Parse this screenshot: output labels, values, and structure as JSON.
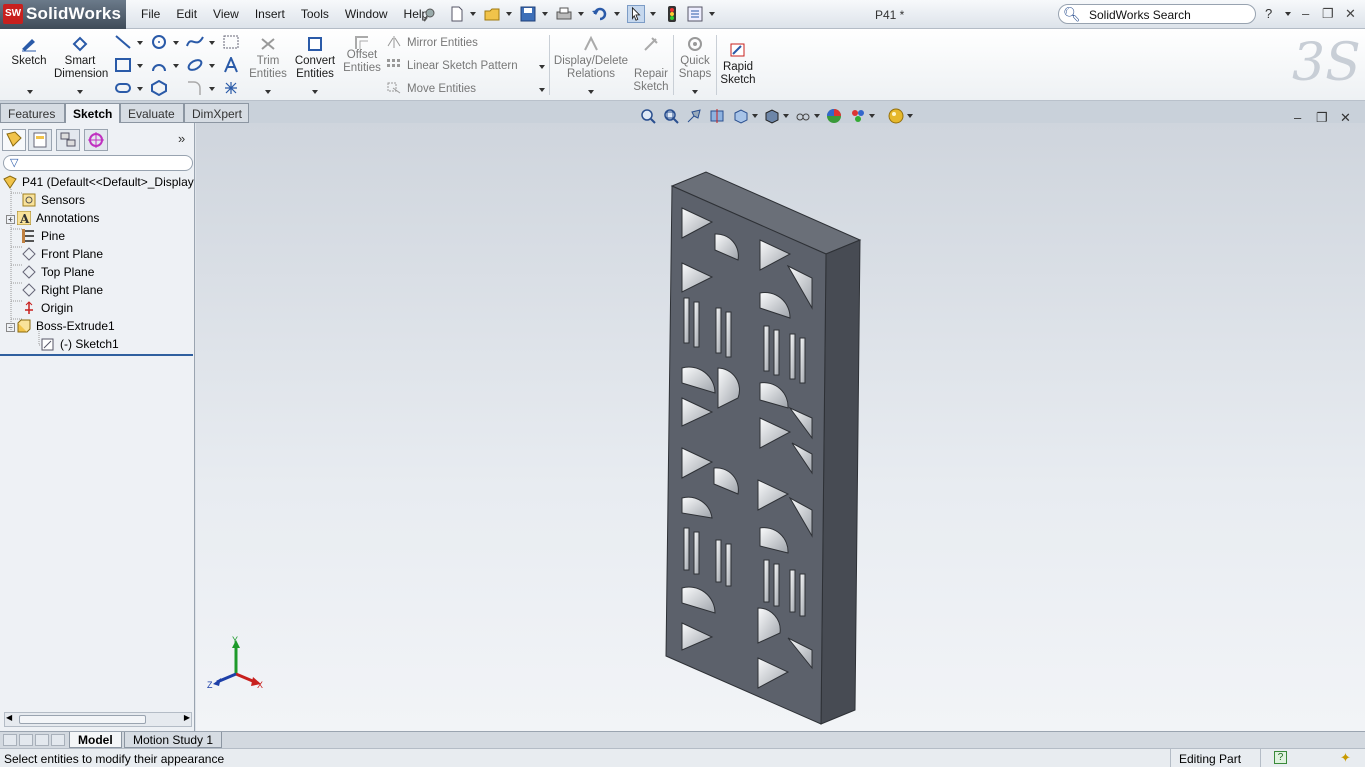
{
  "app": {
    "logo_badge": "SW",
    "logo_name": "SolidWorks",
    "document_title": "P41 *"
  },
  "menu": [
    "File",
    "Edit",
    "View",
    "Insert",
    "Tools",
    "Window",
    "Help"
  ],
  "search": {
    "placeholder": "SolidWorks Search"
  },
  "ribbon": {
    "sketch": "Sketch",
    "smart_dimension_1": "Smart",
    "smart_dimension_2": "Dimension",
    "trim_1": "Trim",
    "trim_2": "Entities",
    "convert_1": "Convert",
    "convert_2": "Entities",
    "offset_1": "Offset",
    "offset_2": "Entities",
    "mirror": "Mirror Entities",
    "linear_pattern": "Linear Sketch Pattern",
    "move": "Move Entities",
    "display_delete_1": "Display/Delete",
    "display_delete_2": "Relations",
    "repair_1": "Repair",
    "repair_2": "Sketch",
    "quick_snaps_1": "Quick",
    "quick_snaps_2": "Snaps",
    "rapid_sketch_1": "Rapid",
    "rapid_sketch_2": "Sketch"
  },
  "tabs": [
    "Features",
    "Sketch",
    "Evaluate",
    "DimXpert"
  ],
  "active_tab": "Sketch",
  "feature_tree": {
    "root": "P41  (Default<<Default>_Display",
    "items": [
      {
        "label": "Sensors",
        "icon": "sensor-icon"
      },
      {
        "label": "Annotations",
        "icon": "annotation-icon"
      },
      {
        "label": "Pine",
        "icon": "material-icon"
      },
      {
        "label": "Front Plane",
        "icon": "plane-icon"
      },
      {
        "label": "Top Plane",
        "icon": "plane-icon"
      },
      {
        "label": "Right Plane",
        "icon": "plane-icon"
      },
      {
        "label": "Origin",
        "icon": "origin-icon"
      },
      {
        "label": "Boss-Extrude1",
        "icon": "extrude-icon"
      },
      {
        "label": "(-) Sketch1",
        "icon": "sketch-icon"
      }
    ]
  },
  "triad": {
    "x": "X",
    "y": "Y",
    "z": "Z"
  },
  "bottom_tabs": [
    "Model",
    "Motion Study 1"
  ],
  "status": {
    "message": "Select entities to modify their appearance",
    "mode": "Editing Part"
  },
  "colors": {
    "accent": "#2f5f9f",
    "model_face": "#5c616b",
    "model_side": "#474b53",
    "logo_red": "#c8201e"
  }
}
